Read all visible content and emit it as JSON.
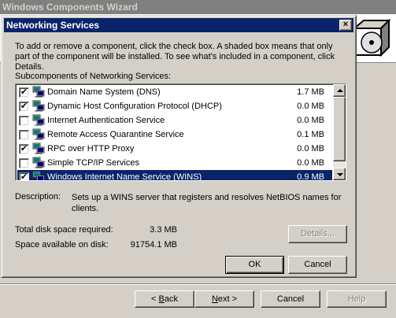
{
  "wizard": {
    "title": "Windows Components Wizard",
    "buttons": {
      "back": "< Back",
      "back_mnemonic": "B",
      "next": "Next >",
      "next_mnemonic": "N",
      "cancel": "Cancel",
      "help": "Help"
    },
    "icon": "cd-box-icon"
  },
  "dialog": {
    "title": "Networking Services",
    "close_label": "×",
    "intro": "To add or remove a component, click the check box. A shaded box means that only part of the component will be installed. To see what's included in a component, click Details.",
    "subcomponents_label": "Subcomponents of Networking Services:",
    "components": [
      {
        "name": "Domain Name System (DNS)",
        "size": "1.7 MB",
        "checked": true,
        "selected": false
      },
      {
        "name": "Dynamic Host Configuration Protocol (DHCP)",
        "size": "0.0 MB",
        "checked": true,
        "selected": false
      },
      {
        "name": "Internet Authentication Service",
        "size": "0.0 MB",
        "checked": false,
        "selected": false
      },
      {
        "name": "Remote Access Quarantine Service",
        "size": "0.1 MB",
        "checked": false,
        "selected": false
      },
      {
        "name": "RPC over HTTP Proxy",
        "size": "0.0 MB",
        "checked": true,
        "selected": false
      },
      {
        "name": "Simple TCP/IP Services",
        "size": "0.0 MB",
        "checked": false,
        "selected": false
      },
      {
        "name": "Windows Internet Name Service (WINS)",
        "size": "0.9 MB",
        "checked": true,
        "selected": true
      }
    ],
    "description_label": "Description:",
    "description": "Sets up a WINS server that registers and resolves NetBIOS names for clients.",
    "disk_required_label": "Total disk space required:",
    "disk_required_value": "3.3 MB",
    "space_available_label": "Space available on disk:",
    "space_available_value": "91754.1 MB",
    "details_label": "Details...",
    "ok_label": "OK",
    "cancel_label": "Cancel"
  }
}
